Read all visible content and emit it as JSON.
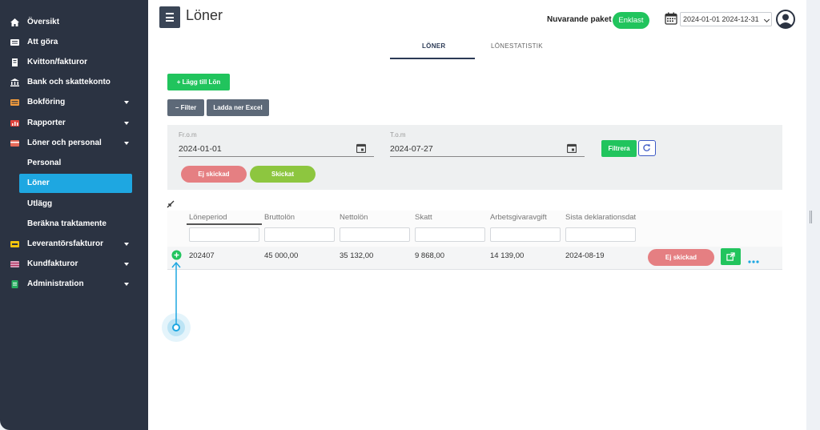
{
  "sidebar": {
    "items": [
      {
        "label": "Översikt",
        "icon": "home-icon",
        "has_children": false
      },
      {
        "label": "Att göra",
        "icon": "list-icon",
        "has_children": false
      },
      {
        "label": "Kvitton/fakturor",
        "icon": "receipt-icon",
        "has_children": false
      },
      {
        "label": "Bank och skattekonto",
        "icon": "bank-icon",
        "has_children": false
      },
      {
        "label": "Bokföring",
        "icon": "ledger-icon",
        "has_children": true
      },
      {
        "label": "Rapporter",
        "icon": "report-icon",
        "has_children": true
      },
      {
        "label": "Löner och personal",
        "icon": "wallet-icon",
        "has_children": true
      }
    ],
    "sub_items": [
      {
        "label": "Personal",
        "active": false
      },
      {
        "label": "Löner",
        "active": true
      },
      {
        "label": "Utlägg",
        "active": false
      },
      {
        "label": "Beräkna traktamente",
        "active": false
      }
    ],
    "items_after": [
      {
        "label": "Leverantörsfakturor",
        "icon": "supplier-invoice-icon",
        "has_children": true
      },
      {
        "label": "Kundfakturor",
        "icon": "customer-invoice-icon",
        "has_children": true
      },
      {
        "label": "Administration",
        "icon": "admin-icon",
        "has_children": true
      }
    ]
  },
  "header": {
    "title": "Löner",
    "package_label": "Nuvarande paket",
    "package_value": "Enklast",
    "date_range": "2024-01-01 2024-12-31"
  },
  "tabs": [
    {
      "label": "LÖNER",
      "active": true
    },
    {
      "label": "LÖNESTATISTIK",
      "active": false
    }
  ],
  "toolbar": {
    "add_label": "Lägg till Lön",
    "filter_label": "Filter",
    "excel_label": "Ladda ner Excel"
  },
  "filters": {
    "from_label": "Fr.o.m",
    "from_value": "2024-01-01",
    "to_label": "T.o.m",
    "to_value": "2024-07-27",
    "apply_label": "Filtrera",
    "status_not_sent": "Ej skickad",
    "status_sent": "Skickat"
  },
  "table": {
    "columns": [
      "Löneperiod",
      "Bruttolön",
      "Nettolön",
      "Skatt",
      "Arbetsgivaravgift",
      "Sista deklarationsdat"
    ],
    "rows": [
      {
        "cells": [
          "202407",
          "45 000,00",
          "35 132,00",
          "9 868,00",
          "14 139,00",
          "2024-08-19"
        ],
        "status": "Ej skickad"
      }
    ]
  },
  "colors": {
    "sidebar_bg": "#2b3342",
    "active_item": "#1ea7e1",
    "green": "#21c45d",
    "status_red": "#e57f82",
    "status_green": "#8dc63f",
    "tour_blue": "#1ea7e1"
  }
}
